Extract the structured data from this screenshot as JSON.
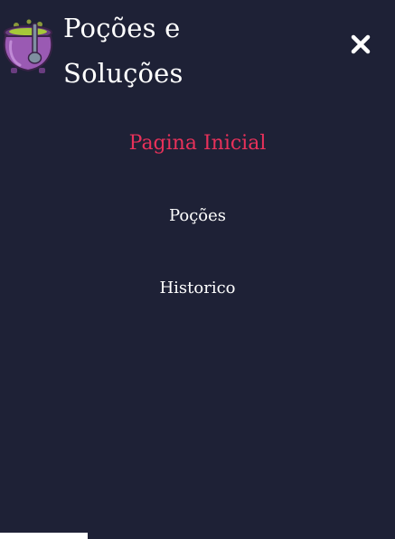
{
  "brand": {
    "line1": "Poções e",
    "line2": "Soluções",
    "logo_icon": "cauldron-icon"
  },
  "close_icon": "close-icon",
  "nav": {
    "items": [
      {
        "label": "Pagina Inicial",
        "active": true
      },
      {
        "label": "Poções",
        "active": false
      },
      {
        "label": "Historico",
        "active": false
      }
    ]
  },
  "colors": {
    "background": "#1e2136",
    "active": "#e8315a",
    "text": "#ffffff",
    "cauldron": "#9a5ab3"
  }
}
